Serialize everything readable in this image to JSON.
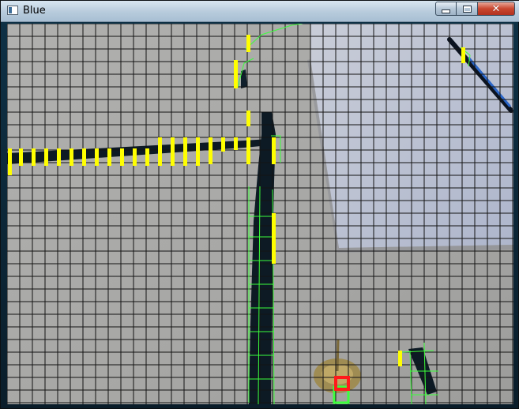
{
  "window": {
    "title": "Blue",
    "icon": "window-app-icon",
    "controls": {
      "minimize_icon": "minimize-icon",
      "maximize_icon": "maximize-icon",
      "close_label": "✕"
    }
  },
  "colors": {
    "grid_line": "#141414",
    "floor": "#a8a8a8",
    "tape": "#0d1a24",
    "marker_yellow": "#ffff00",
    "outline_green": "#3cff3c",
    "target_red": "#ff1a1a",
    "paper": "#c2c8d8"
  }
}
